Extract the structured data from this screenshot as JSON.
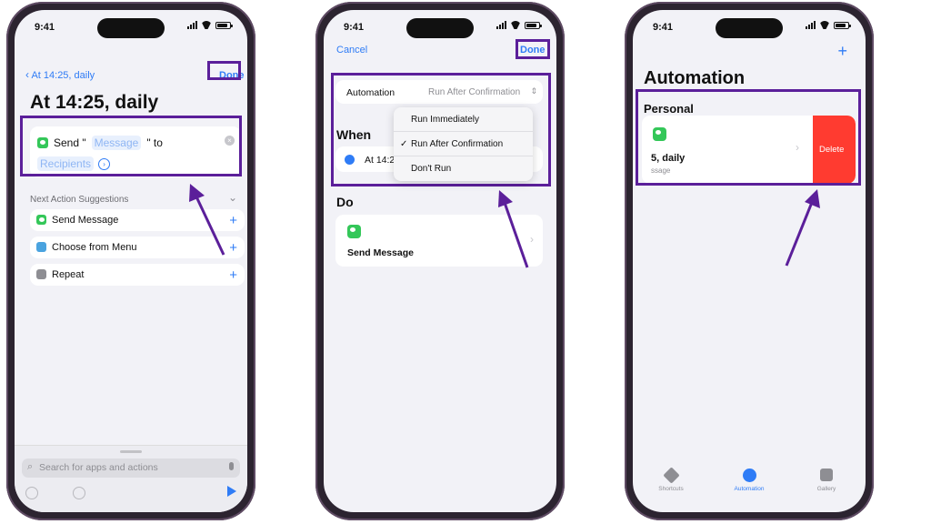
{
  "phone1": {
    "time": "9:41",
    "back_label": "At 14:25, daily",
    "done_label": "Done",
    "title": "At 14:25, daily",
    "action": {
      "send_text": "Send \"",
      "message_token": "Message",
      "to_text": "\" to",
      "recipients_token": "Recipients"
    },
    "suggestions_header": "Next Action Suggestions",
    "suggestions": [
      {
        "label": "Send Message",
        "icon": "messages-icon"
      },
      {
        "label": "Choose from Menu",
        "icon": "menu-icon"
      },
      {
        "label": "Repeat",
        "icon": "repeat-icon"
      }
    ],
    "search_placeholder": "Search for apps and actions"
  },
  "phone2": {
    "time": "9:41",
    "cancel_label": "Cancel",
    "done_label": "Done",
    "automation_label": "Automation",
    "automation_value": "Run After Confirmation",
    "when_label": "When",
    "when_value": "At 14:2",
    "menu": [
      {
        "label": "Run Immediately",
        "checked": false
      },
      {
        "label": "Run After Confirmation",
        "checked": true
      },
      {
        "label": "Don't Run",
        "checked": false
      }
    ],
    "check_mark": "✓",
    "do_label": "Do",
    "do_action": "Send Message"
  },
  "phone3": {
    "time": "9:41",
    "title": "Automation",
    "section": "Personal",
    "row_title": "5, daily",
    "row_subtitle": "ssage",
    "delete_label": "Delete",
    "tabs": [
      {
        "label": "Shortcuts",
        "active": false
      },
      {
        "label": "Automation",
        "active": true
      },
      {
        "label": "Gallery",
        "active": false
      }
    ]
  },
  "colors": {
    "accent": "#2f7cf6",
    "highlight": "#5b1f9a",
    "delete": "#ff3b30",
    "messages_green": "#34c759",
    "frame": "#2c2430"
  }
}
